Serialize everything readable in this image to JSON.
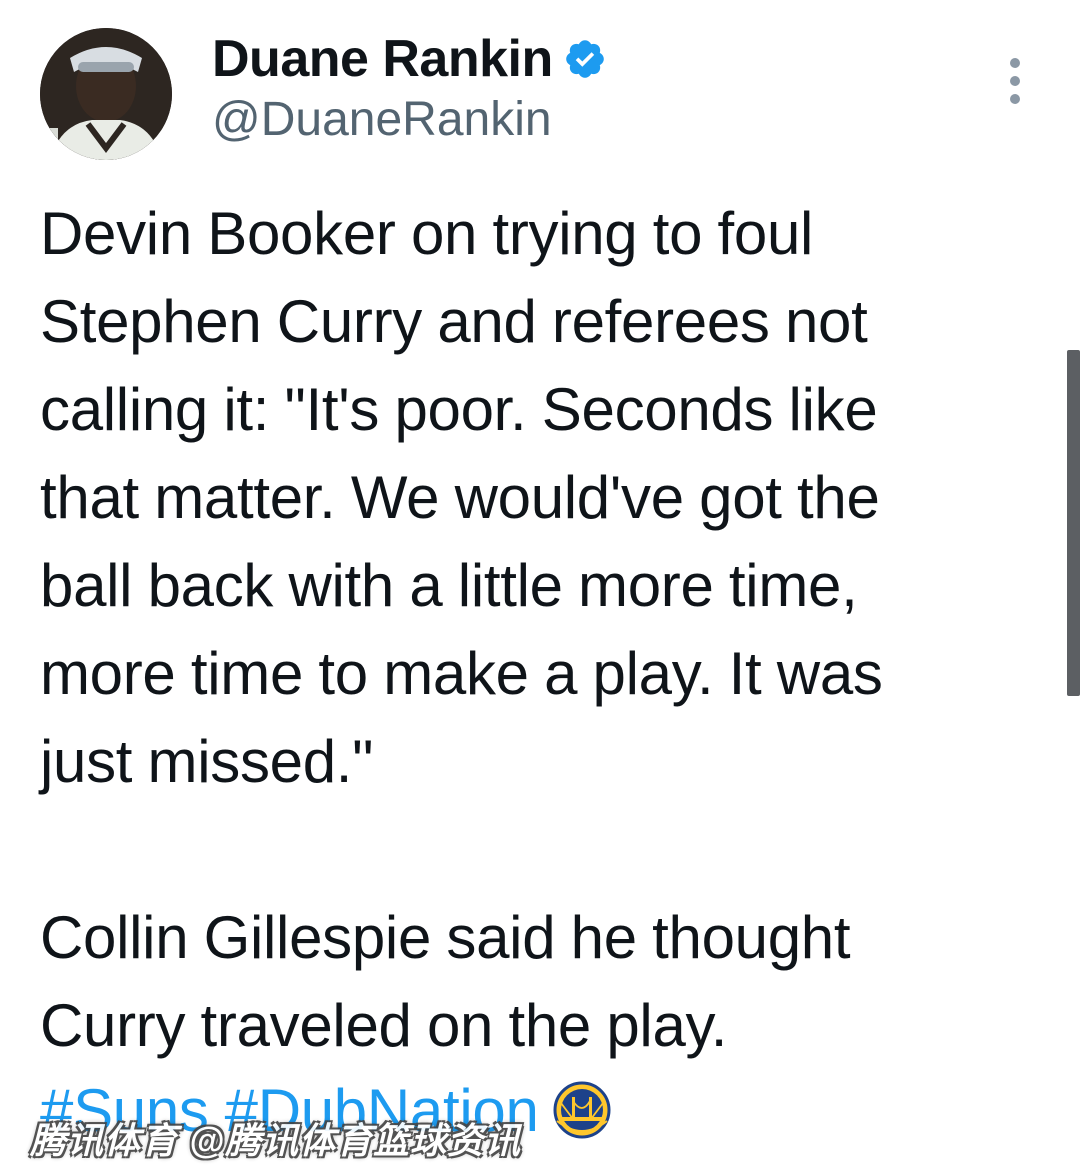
{
  "author": {
    "display_name": "Duane Rankin",
    "handle": "@DuaneRankin",
    "verified_icon": "verified-badge-icon",
    "avatar_icon": "profile-avatar"
  },
  "menu": {
    "icon": "more-vertical-icon"
  },
  "tweet": {
    "lines": [
      "Devin Booker on trying to foul",
      "Stephen Curry and referees not",
      "calling it: \"It's poor. Seconds like",
      "that matter. We would've got the",
      "ball back with a little more time,",
      "more time to make a play. It was",
      "just missed.\"",
      "",
      "Collin Gillespie said he thought",
      "Curry traveled on the play."
    ],
    "hashtags": [
      "#Suns",
      "#DubNation"
    ],
    "hashtag_emoji": "warriors-logo-icon"
  },
  "watermark": {
    "text": "腾讯体育 @腾讯体育篮球资讯"
  },
  "colors": {
    "text": "#0f1419",
    "secondary": "#536471",
    "link": "#1d9bf0",
    "verified": "#1d9bf0",
    "warriors_blue": "#1d428a",
    "warriors_gold": "#ffc72c"
  }
}
